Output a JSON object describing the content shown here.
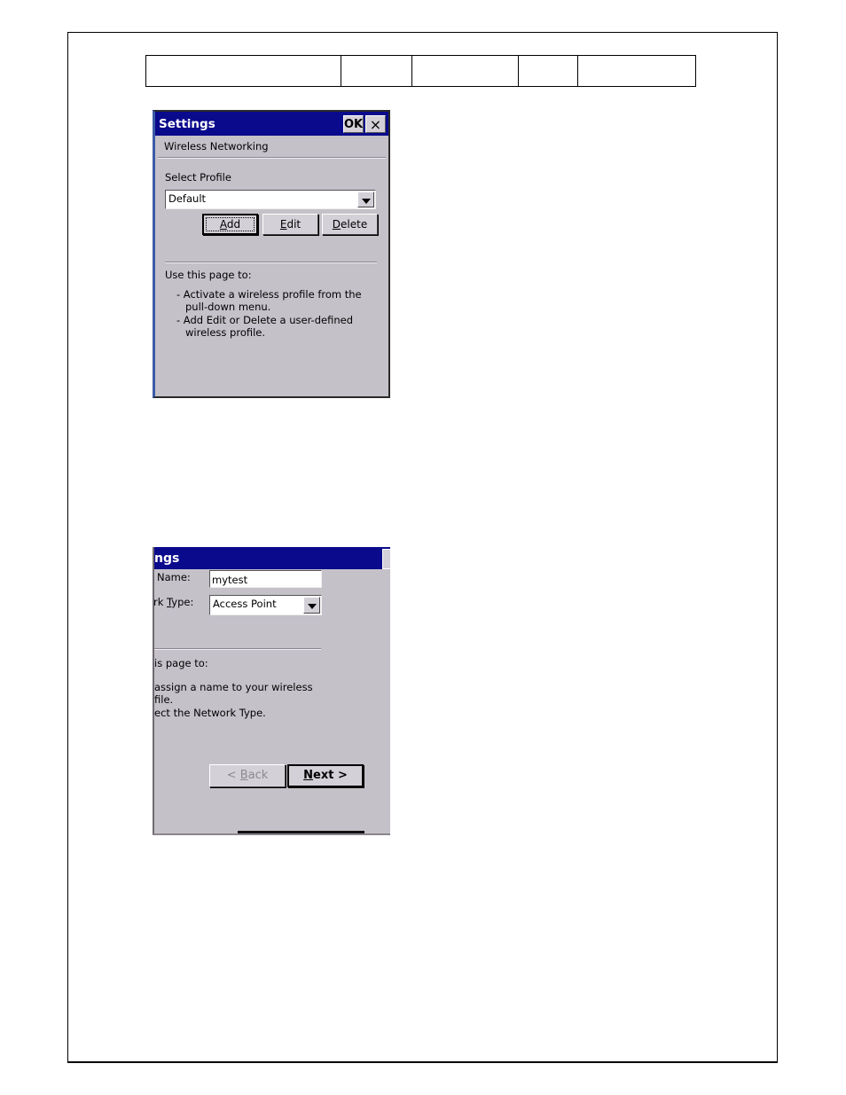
{
  "header_table": {
    "cells": [
      "",
      "",
      "",
      "",
      ""
    ]
  },
  "screenshot1": {
    "title": "Settings",
    "ok_label": "OK",
    "close_label": "×",
    "subtitle": "Wireless Networking",
    "select_profile_label": "Select Profile",
    "profile_value": "Default",
    "buttons": {
      "add": {
        "mnemonic": "A",
        "rest": "dd"
      },
      "edit": {
        "mnemonic": "E",
        "rest": "dit"
      },
      "delete": {
        "mnemonic": "D",
        "rest": "elete"
      }
    },
    "help_heading": "Use this page to:",
    "help_items": [
      {
        "line1": "- Activate a wireless profile from the",
        "line2": "pull-down menu."
      },
      {
        "line1": "- Add Edit or Delete a user-defined",
        "line2": "wireless profile."
      }
    ]
  },
  "screenshot2": {
    "title": "ngs",
    "name_label": "Name:",
    "name_value": "mytest",
    "type_label_prefix": "rk ",
    "type_label_mnemonic": "T",
    "type_label_rest": "ype:",
    "type_value": "Access Point",
    "help_heading": "is page to:",
    "help_lines": [
      "assign a name to your wireless",
      "file.",
      "ect the Network Type."
    ],
    "back": {
      "prefix": "< ",
      "mnemonic": "B",
      "rest": "ack"
    },
    "next": {
      "mnemonic": "N",
      "rest": "ext >"
    }
  }
}
